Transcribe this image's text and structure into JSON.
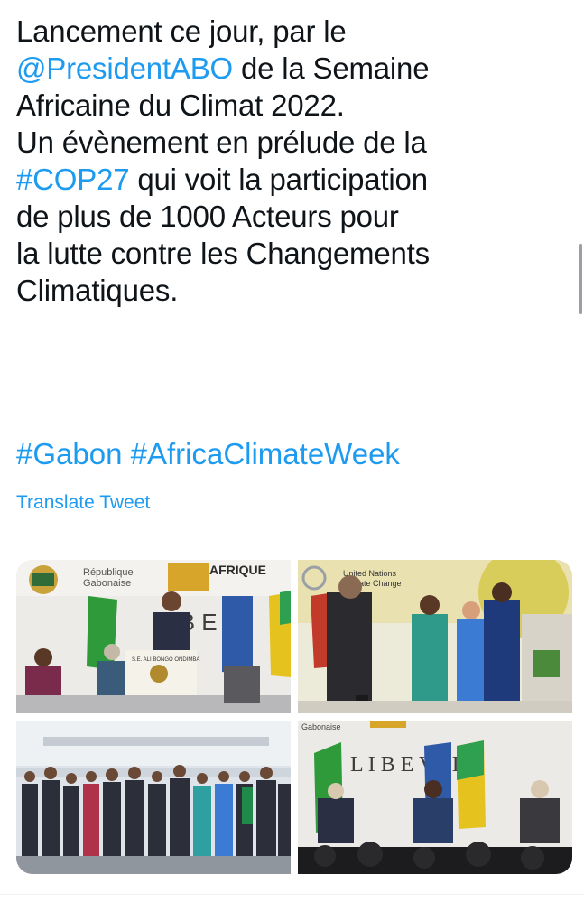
{
  "tweet": {
    "lines": [
      [
        "Lancement ce jour, par le",
        ""
      ],
      [
        "@PresidentABO",
        " de la Semaine"
      ],
      [
        "Africaine du Climat 2022.",
        ""
      ],
      [
        "Un évènement en prélude de la",
        ""
      ],
      [
        "#COP27",
        " qui voit la participation"
      ],
      [
        "de plus de 1000 Acteurs pour",
        ""
      ],
      [
        "la lutte contre les Changements",
        ""
      ],
      [
        "Climatiques.",
        ""
      ]
    ],
    "hashtag_1": "#Gabon",
    "hashtag_2": "#AfricaClimateWeek",
    "translate_label": "Translate Tweet"
  },
  "media": {
    "photo_1": {
      "sign_left": "République",
      "sign_left_2": "Gabonaise",
      "banner_text": "AFRIQUE",
      "wall_letters": "L  B  E",
      "podium_text": "S.E. ALI BONGO ONDIMBA"
    },
    "photo_2": {
      "banner_text": "United Nations",
      "banner_text_2": "Climate Change"
    },
    "photo_4": {
      "banner_text": "Gabonaise",
      "wall_letters": "L  I  B     E  V  I  L  L"
    }
  },
  "colors": {
    "text": "#0f1419",
    "link": "#1d9bf0"
  }
}
